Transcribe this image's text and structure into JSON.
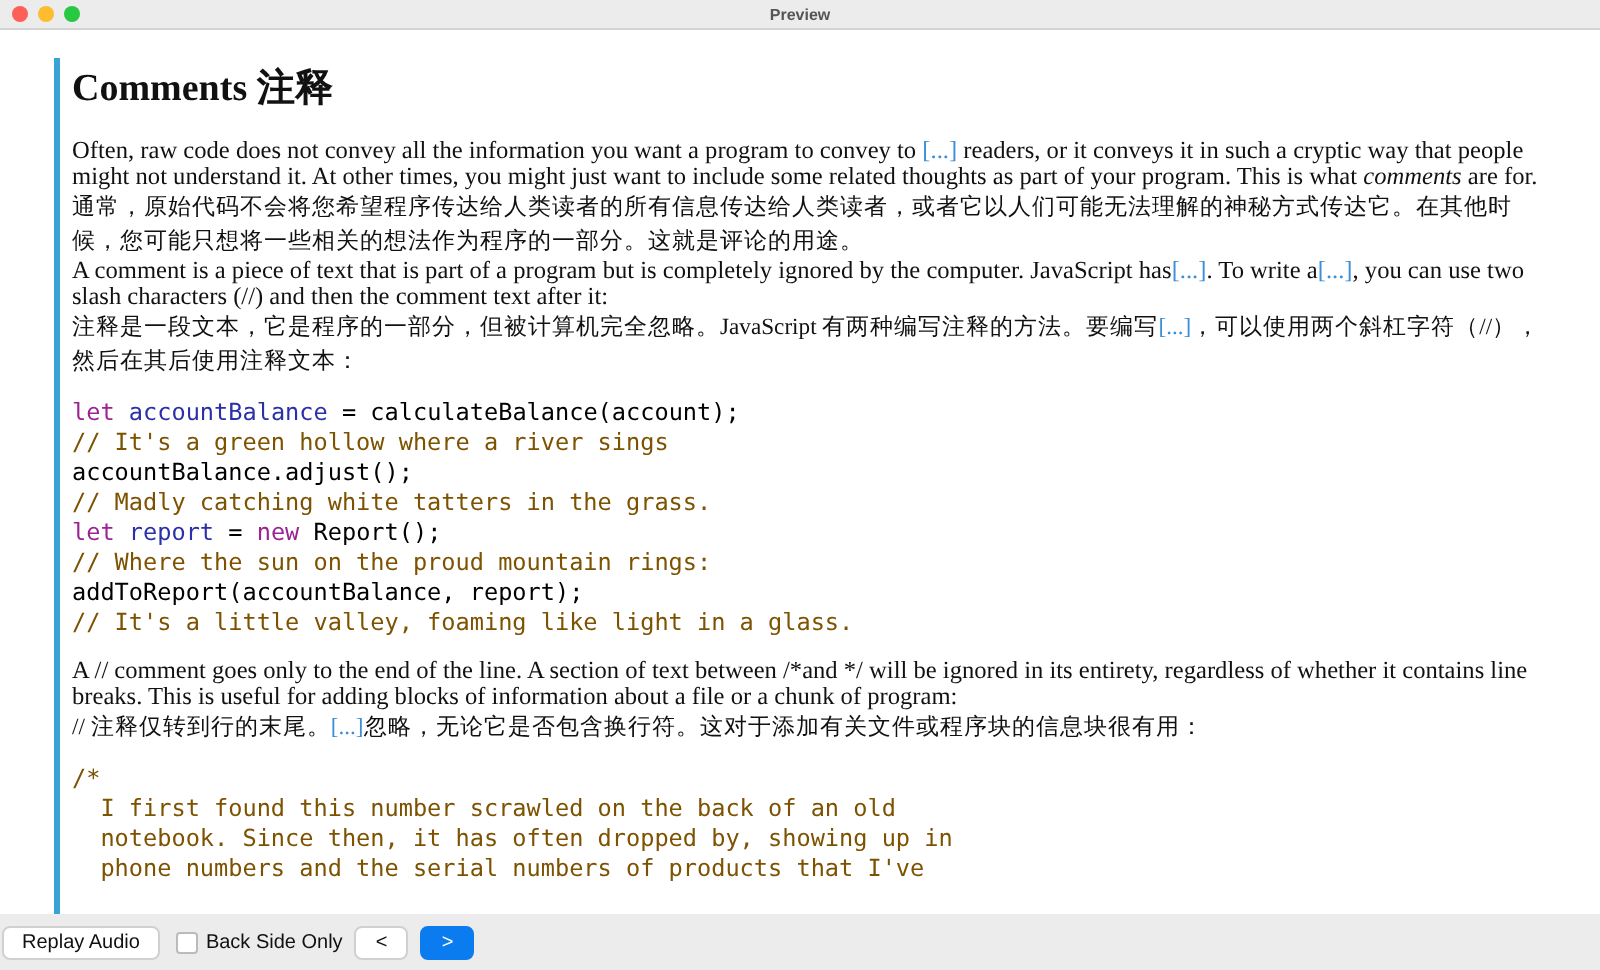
{
  "window": {
    "title": "Preview"
  },
  "heading": "Comments 注释",
  "blocks": [
    {
      "kind": "para",
      "parts": [
        {
          "text": "Often, raw code does not convey all the information you want a program to convey to "
        },
        {
          "link": "[...]"
        },
        {
          "text": " readers, or it conveys it in such a cryptic way that people might not understand it. At other times, you might just want to include some related thoughts as part of your program. This is what *comments* are for."
        }
      ]
    },
    {
      "kind": "para_cjk",
      "parts": [
        {
          "text": "通常，原始代码不会将您希望程序传达给人类读者的所有信息传达给人类读者，或者它以人们可能无法理解的神秘方式传达它。在其他时候，您可能只想将一些相关的想法作为程序的一部分。这就是评论的用途。"
        }
      ]
    },
    {
      "kind": "para",
      "parts": [
        {
          "text": "A comment is a piece of text that is part of a program but is completely ignored by the computer. JavaScript has"
        },
        {
          "link": "[...]"
        },
        {
          "text": ". To write a"
        },
        {
          "link": "[...]"
        },
        {
          "text": ", you can use two slash characters (//) and then the comment text after it:"
        }
      ]
    },
    {
      "kind": "para_cjk",
      "parts": [
        {
          "text": "注释是一段文本，它是程序的一部分，但被计算机完全忽略。JavaScript 有两种编写注释的方法。要编写"
        },
        {
          "link": "[...]"
        },
        {
          "text": "，可以使用两个斜杠字符（//），然后在其后使用注释文本："
        }
      ]
    },
    {
      "kind": "code",
      "lines": [
        [
          {
            "kind": "keyword",
            "text": "let"
          },
          {
            "kind": "variable",
            "text": " accountBalance"
          },
          {
            "kind": "plain",
            "text": " = calculateBalance(account);"
          }
        ],
        [
          {
            "kind": "comment",
            "text": "// It's a green hollow where a river sings"
          }
        ],
        [
          {
            "kind": "plain",
            "text": "accountBalance.adjust();"
          }
        ],
        [
          {
            "kind": "comment",
            "text": "// Madly catching white tatters in the grass."
          }
        ],
        [
          {
            "kind": "keyword",
            "text": "let"
          },
          {
            "kind": "variable",
            "text": " report"
          },
          {
            "kind": "plain",
            "text": " = "
          },
          {
            "kind": "keyword",
            "text": "new"
          },
          {
            "kind": "plain",
            "text": " Report();"
          }
        ],
        [
          {
            "kind": "comment",
            "text": "// Where the sun on the proud mountain rings:"
          }
        ],
        [
          {
            "kind": "plain",
            "text": "addToReport(accountBalance, report);"
          }
        ],
        [
          {
            "kind": "comment",
            "text": "// It's a little valley, foaming like light in a glass."
          }
        ]
      ]
    },
    {
      "kind": "para",
      "parts": [
        {
          "text": "A // comment goes only to the end of the line. A section of text between /*and */ will be ignored in its entirety, regardless of whether it contains line breaks. This is useful for adding blocks of information about a file or a chunk of program:"
        }
      ]
    },
    {
      "kind": "para_cjk",
      "parts": [
        {
          "text": "// 注释仅转到行的末尾。"
        },
        {
          "link": "[...]"
        },
        {
          "text": "忽略，无论它是否包含换行符。这对于添加有关文件或程序块的信息块很有用："
        }
      ]
    },
    {
      "kind": "code",
      "lines": [
        [
          {
            "kind": "comment",
            "text": "/*"
          }
        ],
        [
          {
            "kind": "comment",
            "text": "  I first found this number scrawled on the back of an old"
          }
        ],
        [
          {
            "kind": "comment",
            "text": "  notebook. Since then, it has often dropped by, showing up in"
          }
        ],
        [
          {
            "kind": "comment",
            "text": "  phone numbers and the serial numbers of products that I've"
          }
        ]
      ]
    }
  ],
  "toolbar": {
    "replay": "Replay Audio",
    "back_side_only": {
      "label": "Back Side Only",
      "checked": false
    },
    "prev": "<",
    "next": ">"
  }
}
